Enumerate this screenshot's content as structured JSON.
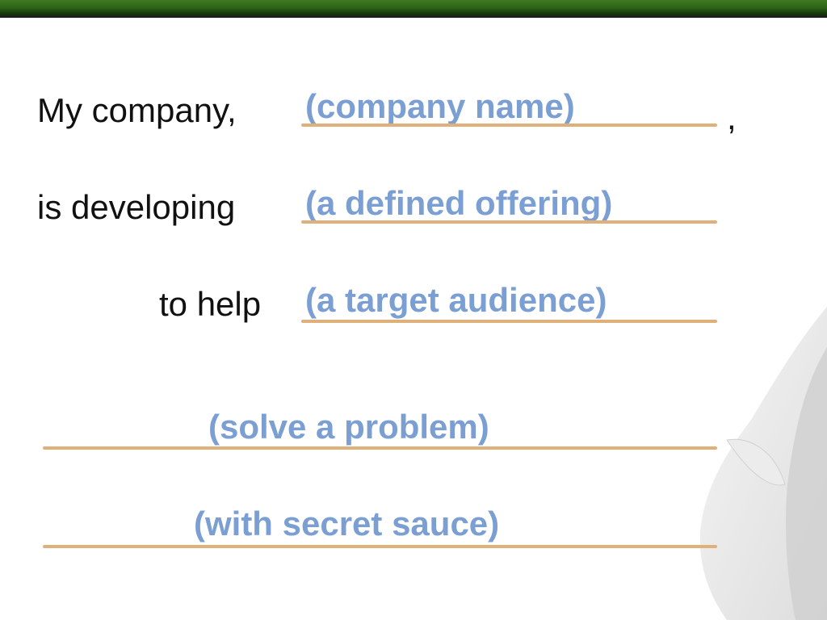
{
  "lines": [
    {
      "label": "My company,",
      "blank": "(company name)",
      "suffix": ","
    },
    {
      "label": "is developing",
      "blank": "(a defined offering)"
    },
    {
      "label": "to help",
      "blank": "(a target audience)"
    },
    {
      "blank": "(solve a problem)"
    },
    {
      "blank": "(with secret sauce)"
    }
  ],
  "colors": {
    "header_bar": "#2d6218",
    "blank_text": "#7b9fd3",
    "underline": "#e0b07a",
    "label_text": "#111111"
  }
}
